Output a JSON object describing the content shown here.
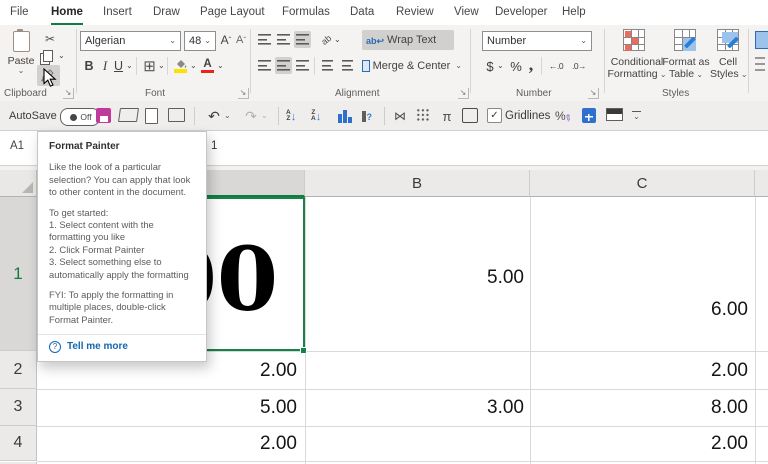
{
  "menu": {
    "tabs": [
      {
        "label": "File"
      },
      {
        "label": "Home"
      },
      {
        "label": "Insert"
      },
      {
        "label": "Draw"
      },
      {
        "label": "Page Layout"
      },
      {
        "label": "Formulas"
      },
      {
        "label": "Data"
      },
      {
        "label": "Review"
      },
      {
        "label": "View"
      },
      {
        "label": "Developer"
      },
      {
        "label": "Help"
      }
    ]
  },
  "ribbon": {
    "clipboard": {
      "group_label": "Clipboard",
      "paste_label": "Paste"
    },
    "font": {
      "group_label": "Font",
      "family": "Algerian",
      "size": "48",
      "bold": "B",
      "italic": "I",
      "underline": "U",
      "color_letter": "A"
    },
    "alignment": {
      "group_label": "Alignment",
      "wrap_text": "Wrap Text",
      "merge_center": "Merge & Center"
    },
    "number": {
      "group_label": "Number",
      "format": "Number"
    },
    "styles": {
      "group_label": "Styles",
      "conditional_line1": "Conditional",
      "conditional_line2": "Formatting",
      "format_table_line1": "Format as",
      "format_table_line2": "Table",
      "cell_styles_line1": "Cell",
      "cell_styles_line2": "Styles"
    }
  },
  "qat": {
    "autosave_label": "AutoSave",
    "autosave_state": "Off",
    "gridlines_label": "Gridlines"
  },
  "formula_bar": {
    "name_box": "A1",
    "value": "1"
  },
  "tooltip": {
    "title": "Format Painter",
    "intro": "Like the look of a particular selection? You can apply that look to other content in the document.",
    "get_started": "To get started:",
    "step1": "1. Select content with the formatting you like",
    "step2": "2. Click Format Painter",
    "step3": "3. Select something else to automatically apply the formatting",
    "fyi": "FYI: To apply the formatting in multiple places, double-click Format Painter.",
    "link": "Tell me more"
  },
  "sheet": {
    "col_headers": {
      "b": "B",
      "c": "C"
    },
    "row_headers": {
      "r1": "1",
      "r2": "2",
      "r3": "3",
      "r4": "4"
    },
    "cells": {
      "a1": "1.00",
      "a2": "2.00",
      "a3": "5.00",
      "a4": "2.00",
      "b1": "5.00",
      "b3": "3.00",
      "c1": "6.00",
      "c2": "2.00",
      "c3": "8.00",
      "c4": "2.00"
    }
  },
  "colors": {
    "accent_green": "#107c41",
    "highlight_gray": "#d2d0ce",
    "link_blue": "#1168b0",
    "save_magenta": "#c03a9b"
  }
}
